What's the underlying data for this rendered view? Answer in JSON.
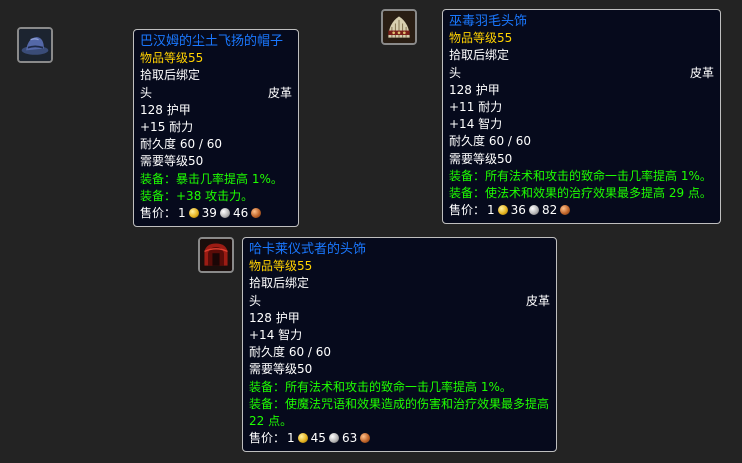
{
  "items": [
    {
      "icon": "blue-hat-icon",
      "name": "巴汉姆的尘土飞扬的帽子",
      "item_level": "物品等级55",
      "bind": "拾取后绑定",
      "slot": "头",
      "armor_type": "皮革",
      "armor": "128 护甲",
      "stats": [
        "+15 耐力"
      ],
      "durability": "耐久度 60 / 60",
      "required_level": "需要等级50",
      "effects": [
        "装备：暴击几率提高 1%。",
        "装备：+38 攻击力。"
      ],
      "sell_label": "售价：",
      "price": {
        "gold": "1",
        "silver": "39",
        "copper": "46"
      }
    },
    {
      "icon": "feathered-headdress-icon",
      "name": "巫毒羽毛头饰",
      "item_level": "物品等级55",
      "bind": "拾取后绑定",
      "slot": "头",
      "armor_type": "皮革",
      "armor": "128 护甲",
      "stats": [
        "+11 耐力",
        "+14 智力"
      ],
      "durability": "耐久度 60 / 60",
      "required_level": "需要等级50",
      "effects": [
        "装备：所有法术和攻击的致命一击几率提高 1%。",
        "装备：使法术和效果的治疗效果最多提高 29 点。"
      ],
      "sell_label": "售价：",
      "price": {
        "gold": "1",
        "silver": "36",
        "copper": "82"
      }
    },
    {
      "icon": "red-helm-icon",
      "name": "哈卡莱仪式者的头饰",
      "item_level": "物品等级55",
      "bind": "拾取后绑定",
      "slot": "头",
      "armor_type": "皮革",
      "armor": "128 护甲",
      "stats": [
        "+14 智力"
      ],
      "durability": "耐久度 60 / 60",
      "required_level": "需要等级50",
      "effects": [
        "装备：所有法术和攻击的致命一击几率提高 1%。",
        "装备：使魔法咒语和效果造成的伤害和治疗效果最多提高22 点。"
      ],
      "sell_label": "售价：",
      "price": {
        "gold": "1",
        "silver": "45",
        "copper": "63"
      }
    }
  ],
  "colors": {
    "background": "#232323",
    "tooltip_bg": "#060a1c",
    "item_name": "#1a78ff",
    "item_level": "#ffd100",
    "equip_effect": "#1eff00"
  }
}
